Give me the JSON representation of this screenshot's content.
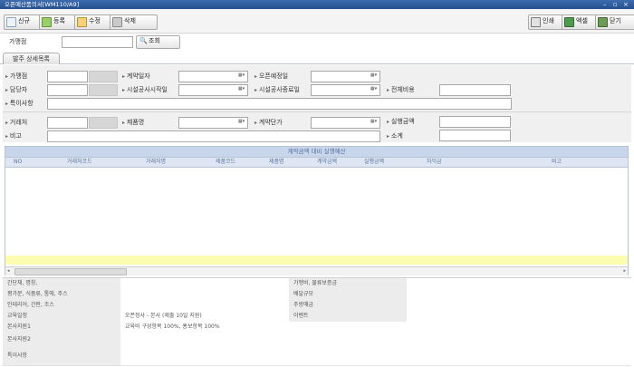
{
  "window": {
    "title": "오픈예산품의서[WM110/A9]",
    "controls": [
      "–",
      "▫",
      "×"
    ]
  },
  "toolbar": {
    "left": [
      {
        "label": "신규",
        "icon": "new-doc-icon"
      },
      {
        "label": "등록",
        "icon": "register-icon"
      },
      {
        "label": "수정",
        "icon": "edit-icon"
      },
      {
        "label": "삭제",
        "icon": "delete-icon"
      }
    ],
    "right": [
      {
        "label": "인쇄",
        "icon": "print-icon"
      },
      {
        "label": "엑셀",
        "icon": "excel-icon"
      },
      {
        "label": "닫기",
        "icon": "close-door-icon"
      }
    ]
  },
  "search": {
    "label": "가맹점",
    "button": "조회"
  },
  "tab": {
    "label": "발주 상세목록"
  },
  "form": {
    "franchise": "가맹점",
    "manager": "담당자",
    "special_note": "특이사항",
    "contract_date": "계약일자",
    "construction_start": "시설공사시작일",
    "open_date": "오픈예정일",
    "construction_end": "시설공사종료일",
    "total_cost": "전체비용",
    "vendor": "거래처",
    "product": "제품명",
    "unit_price": "계약단가",
    "amount": "실행금액",
    "remark": "비고",
    "subtotal": "소계"
  },
  "grid": {
    "caption": "계약금액 대비 실행예산",
    "columns": [
      "NO",
      "거래처코드",
      "거래처명",
      "제품코드",
      "제품명",
      "계약금액",
      "실행금액",
      "차익금",
      "비고"
    ]
  },
  "summary": {
    "rows": [
      {
        "k1": "간단채, 명칭,",
        "v1": "",
        "k2": "가맹비, 물류보증금",
        "v2": ""
      },
      {
        "k1": "평가문, 식품류, 통에, 주스",
        "v1": "",
        "k2": "배달규모",
        "v2": ""
      },
      {
        "k1": "인테리어, 간판, 조스",
        "v1": "",
        "k2": "주방매금",
        "v2": ""
      },
      {
        "k1": "교육일정",
        "v1": "오픈정사 - 본사 (제출 10일 지원)",
        "k2": "이벤트",
        "v2": ""
      },
      {
        "k1": "본사지원1",
        "v1": "교육비 구성항목 100%, 홍보항목 100%",
        "k2": "",
        "v2": ""
      },
      {
        "k1": "본사지원2",
        "v1": "",
        "k2": "",
        "v2": ""
      },
      {
        "k1": "특이사항",
        "v1": "",
        "k2": "",
        "v2": ""
      }
    ]
  },
  "colors": {
    "accent": "#2f5f9f",
    "grid_header": "#c7d6ea",
    "total_row": "#fdfdb0"
  }
}
